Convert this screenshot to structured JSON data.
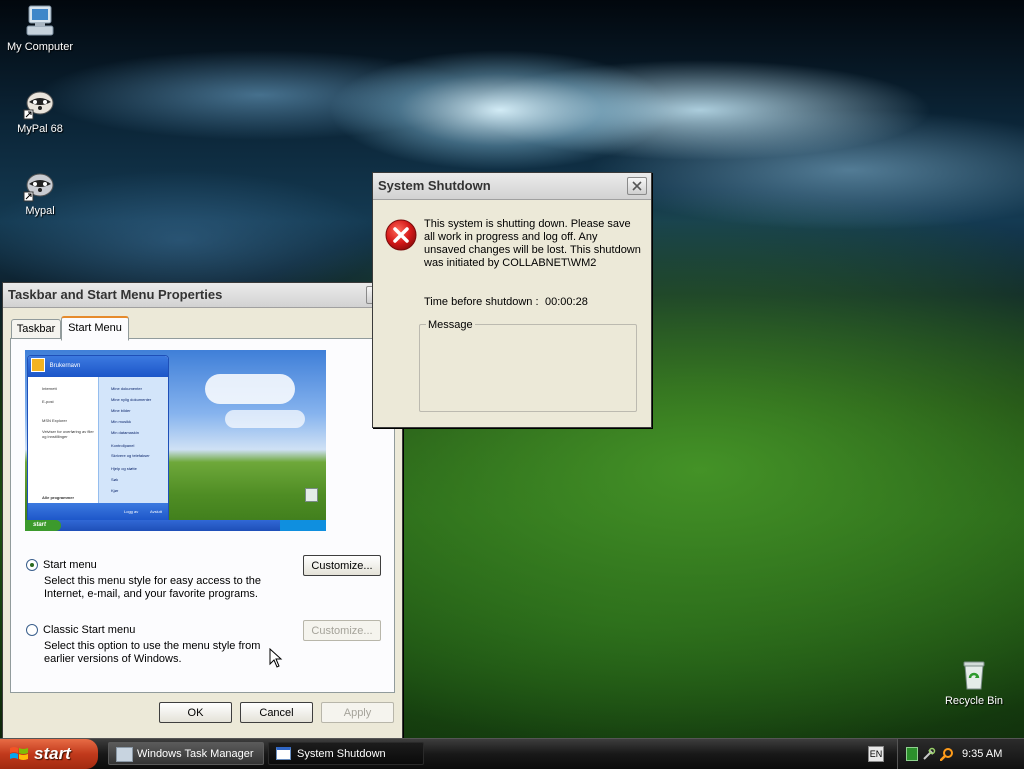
{
  "desktop": {
    "icons": [
      {
        "label": "My Computer"
      },
      {
        "label": "MyPal 68"
      },
      {
        "label": "Mypal"
      },
      {
        "label": "Recycle Bin"
      }
    ]
  },
  "shutdown_dialog": {
    "title": "System Shutdown",
    "message": "This system is shutting down. Please save all work in progress and log off. Any unsaved changes will be lost. This shutdown was initiated by COLLABNET\\WM2",
    "time_label": "Time before shutdown :",
    "time_value": "00:00:28",
    "message_group_label": "Message",
    "message_text": ""
  },
  "taskbar_props": {
    "title": "Taskbar and Start Menu Properties",
    "help": "?",
    "tabs": [
      "Taskbar",
      "Start Menu"
    ],
    "selected_tab": "Start Menu",
    "preview": {
      "user": "Brukernavn",
      "left_items": [
        "Internett",
        "E-post",
        "MSN Explorer",
        "Veiviser for overføring av filer og innstillinger"
      ],
      "right_items": [
        "Mine dokumenter",
        "Mine nylig dokumenter",
        "Mine bilder",
        "Min musikk",
        "Min datamaskin",
        "Kontrollpanel",
        "Skrivere og telefakser",
        "Hjelp og støtte",
        "Søk",
        "Kjør"
      ],
      "all_programs": "Alle programmer",
      "logoff": "Logg av",
      "shutdown": "Avslutt",
      "start": "start"
    },
    "options": [
      {
        "label": "Start menu",
        "checked": true,
        "description": "Select this menu style for easy access to the Internet, e-mail, and your favorite programs.",
        "button": "Customize...",
        "button_enabled": true
      },
      {
        "label": "Classic Start menu",
        "checked": false,
        "description": "Select this option to use the menu style from earlier versions of Windows.",
        "button": "Customize...",
        "button_enabled": false
      }
    ],
    "buttons": {
      "ok": "OK",
      "cancel": "Cancel",
      "apply": "Apply"
    }
  },
  "taskbar": {
    "start_label": "start",
    "tasks": [
      {
        "label": "Windows Task Manager",
        "active": false
      },
      {
        "label": "System Shutdown",
        "active": true
      }
    ],
    "language": "EN",
    "clock": "9:35 AM"
  },
  "colors": {
    "dialog_bg": "#ece9d8",
    "taskbar": "#1a1a1a",
    "start_button": "#c13a1c",
    "error_icon": "#d41818"
  }
}
